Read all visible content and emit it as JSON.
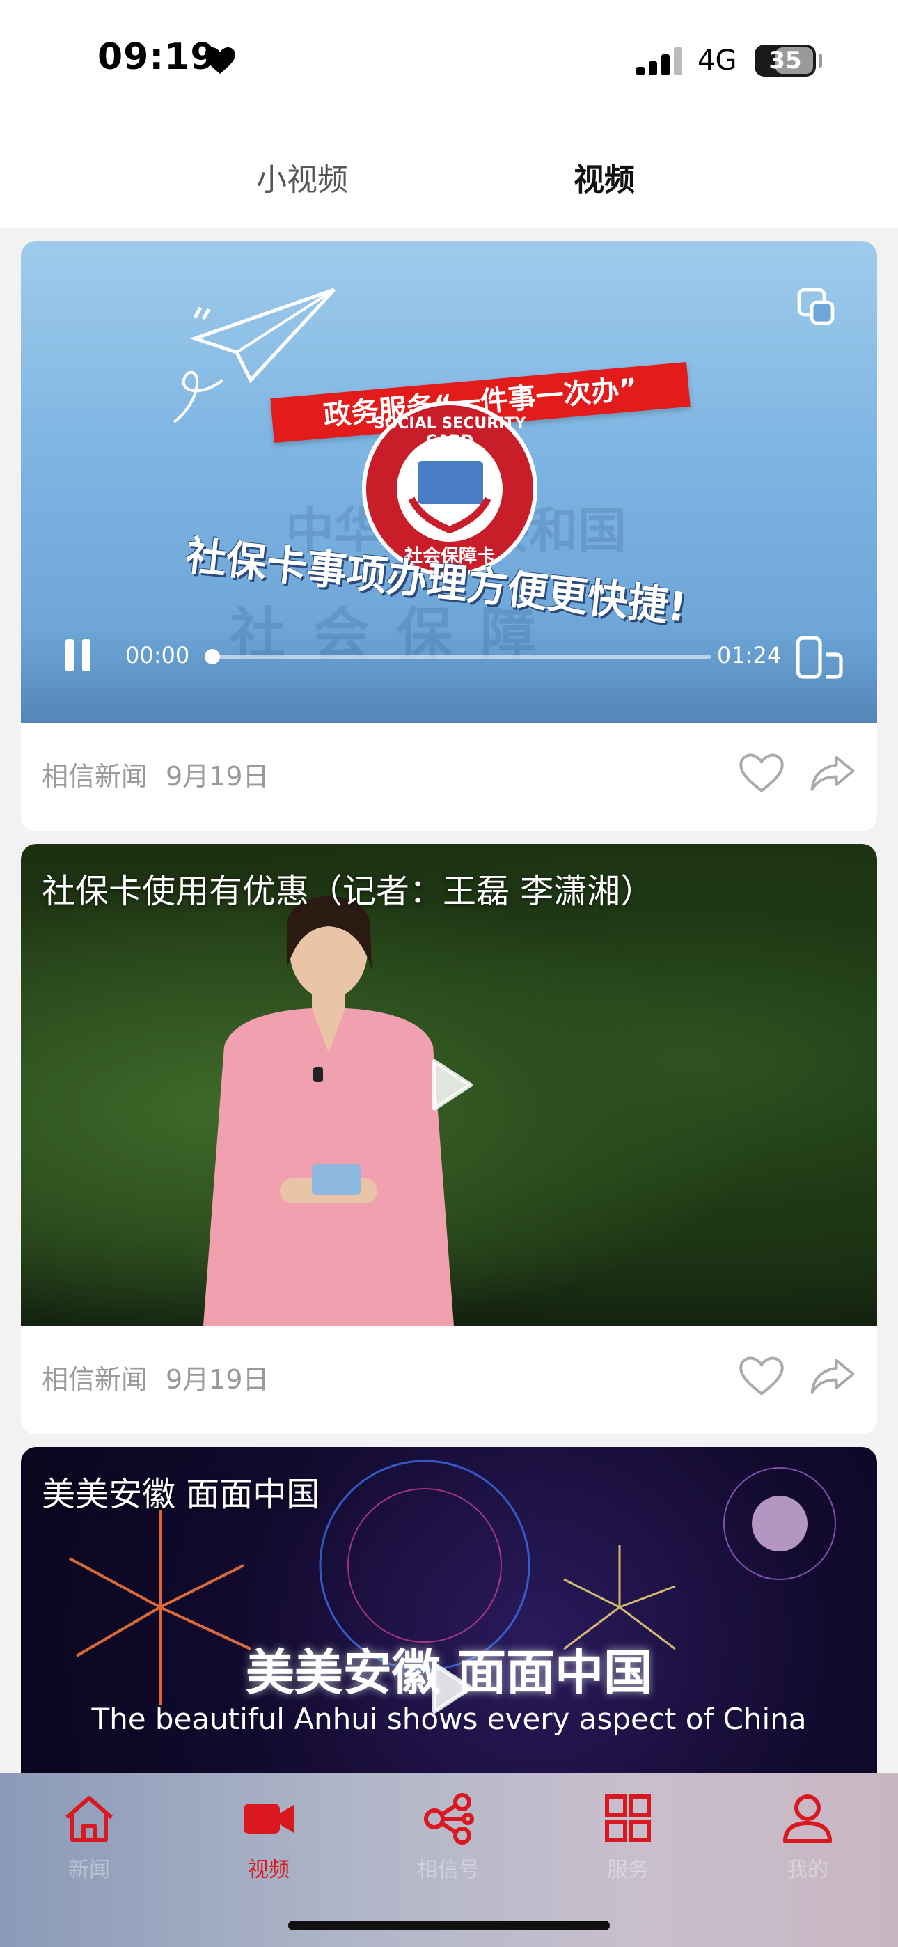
{
  "status_bar": {
    "time": "09:19",
    "network": "4G",
    "battery": "35"
  },
  "top_tabs": [
    {
      "label": "小视频",
      "active": false
    },
    {
      "label": "视频",
      "active": true
    }
  ],
  "feed": [
    {
      "source": "相信新闻",
      "date": "9月19日",
      "player": {
        "current_time": "00:00",
        "duration": "01:24",
        "state": "playing"
      },
      "artwork_text": {
        "banner": "政务服务“一件事一次办”",
        "badge": "SOCIAL SECURITY CARD",
        "badge_sub": "社会保障卡",
        "headline": "社保卡事项办理方便更快捷!",
        "watermark_1": "中华人民共和国",
        "watermark_2": "社会保障"
      }
    },
    {
      "title": "社保卡使用有优惠（记者：王磊 李潇湘）",
      "source": "相信新闻",
      "date": "9月19日"
    },
    {
      "title": "美美安徽 面面中国",
      "artwork_text": {
        "headline_cn": "美美安徽 面面中国",
        "headline_en": "The beautiful Anhui shows every aspect of China"
      }
    }
  ],
  "tab_bar": [
    {
      "label": "新闻",
      "icon": "home-icon",
      "active": false
    },
    {
      "label": "视频",
      "icon": "video-camera-icon",
      "active": true
    },
    {
      "label": "相信号",
      "icon": "share-nodes-icon",
      "active": false
    },
    {
      "label": "服务",
      "icon": "grid-icon",
      "active": false
    },
    {
      "label": "我的",
      "icon": "user-icon",
      "active": false
    }
  ],
  "colors": {
    "accent": "#d9191f",
    "meta_text": "#9a9a9a",
    "background": "#f2f2f2"
  }
}
